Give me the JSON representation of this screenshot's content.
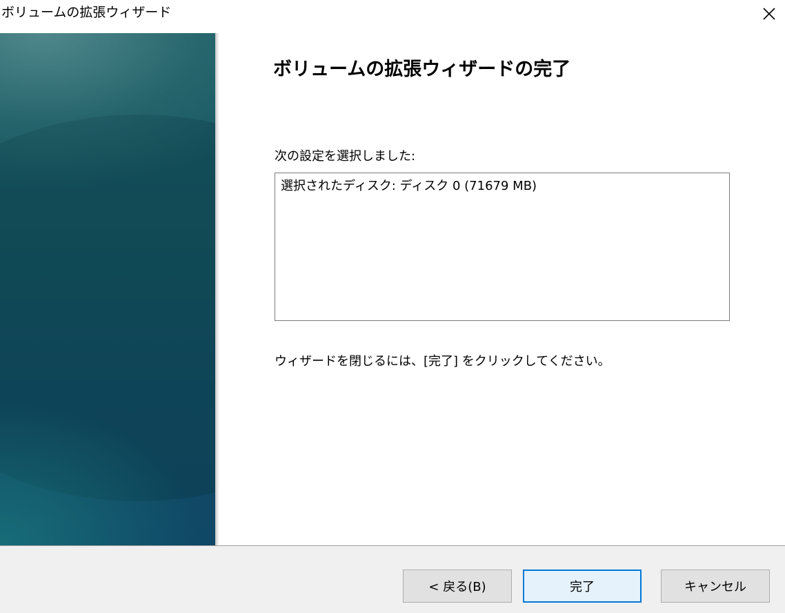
{
  "window": {
    "title": "ボリュームの拡張ウィザード"
  },
  "main": {
    "heading": "ボリュームの拡張ウィザードの完了",
    "settings_label": "次の設定を選択しました:",
    "settings_lines": [
      "選択されたディスク: ディスク 0 (71679 MB)"
    ],
    "instruction": "ウィザードを閉じるには、[完了] をクリックしてください。"
  },
  "footer": {
    "back_label": "< 戻る(B)",
    "finish_label": "完了",
    "cancel_label": "キャンセル"
  },
  "colors": {
    "accent": "#0078d7",
    "footer_bg": "#f0f0f0",
    "side_panel": "#16555f"
  },
  "icons": {
    "close": "close-icon"
  }
}
